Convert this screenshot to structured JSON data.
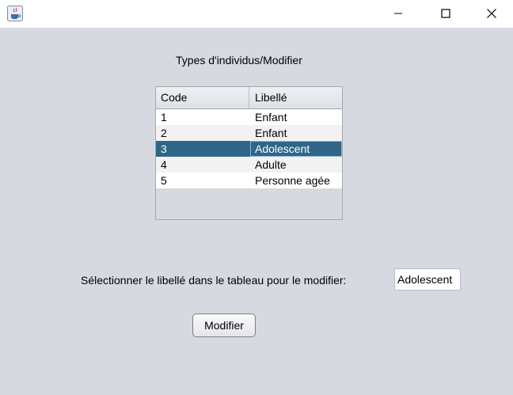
{
  "window": {
    "controls": [
      "minimize-icon",
      "maximize-icon",
      "close-icon"
    ],
    "app_icon": "java-cup-icon"
  },
  "form": {
    "heading": "Types d'individus/Modifier",
    "table": {
      "columns": [
        "Code",
        "Libellé"
      ],
      "rows": [
        {
          "code": "1",
          "libelle": "Enfant"
        },
        {
          "code": "2",
          "libelle": "Enfant"
        },
        {
          "code": "3",
          "libelle": "Adolescent"
        },
        {
          "code": "4",
          "libelle": "Adulte"
        },
        {
          "code": "5",
          "libelle": "Personne agée"
        }
      ],
      "selected_row": 3
    },
    "instruction": "Sélectionner le libellé dans le tableau pour le modifier:",
    "libelle_field_value": "Adolescent",
    "modify_button": "Modifier"
  },
  "colors": {
    "background": "#d6d9e0",
    "selection": "#2f6687",
    "titlebar": "#ffffff"
  }
}
